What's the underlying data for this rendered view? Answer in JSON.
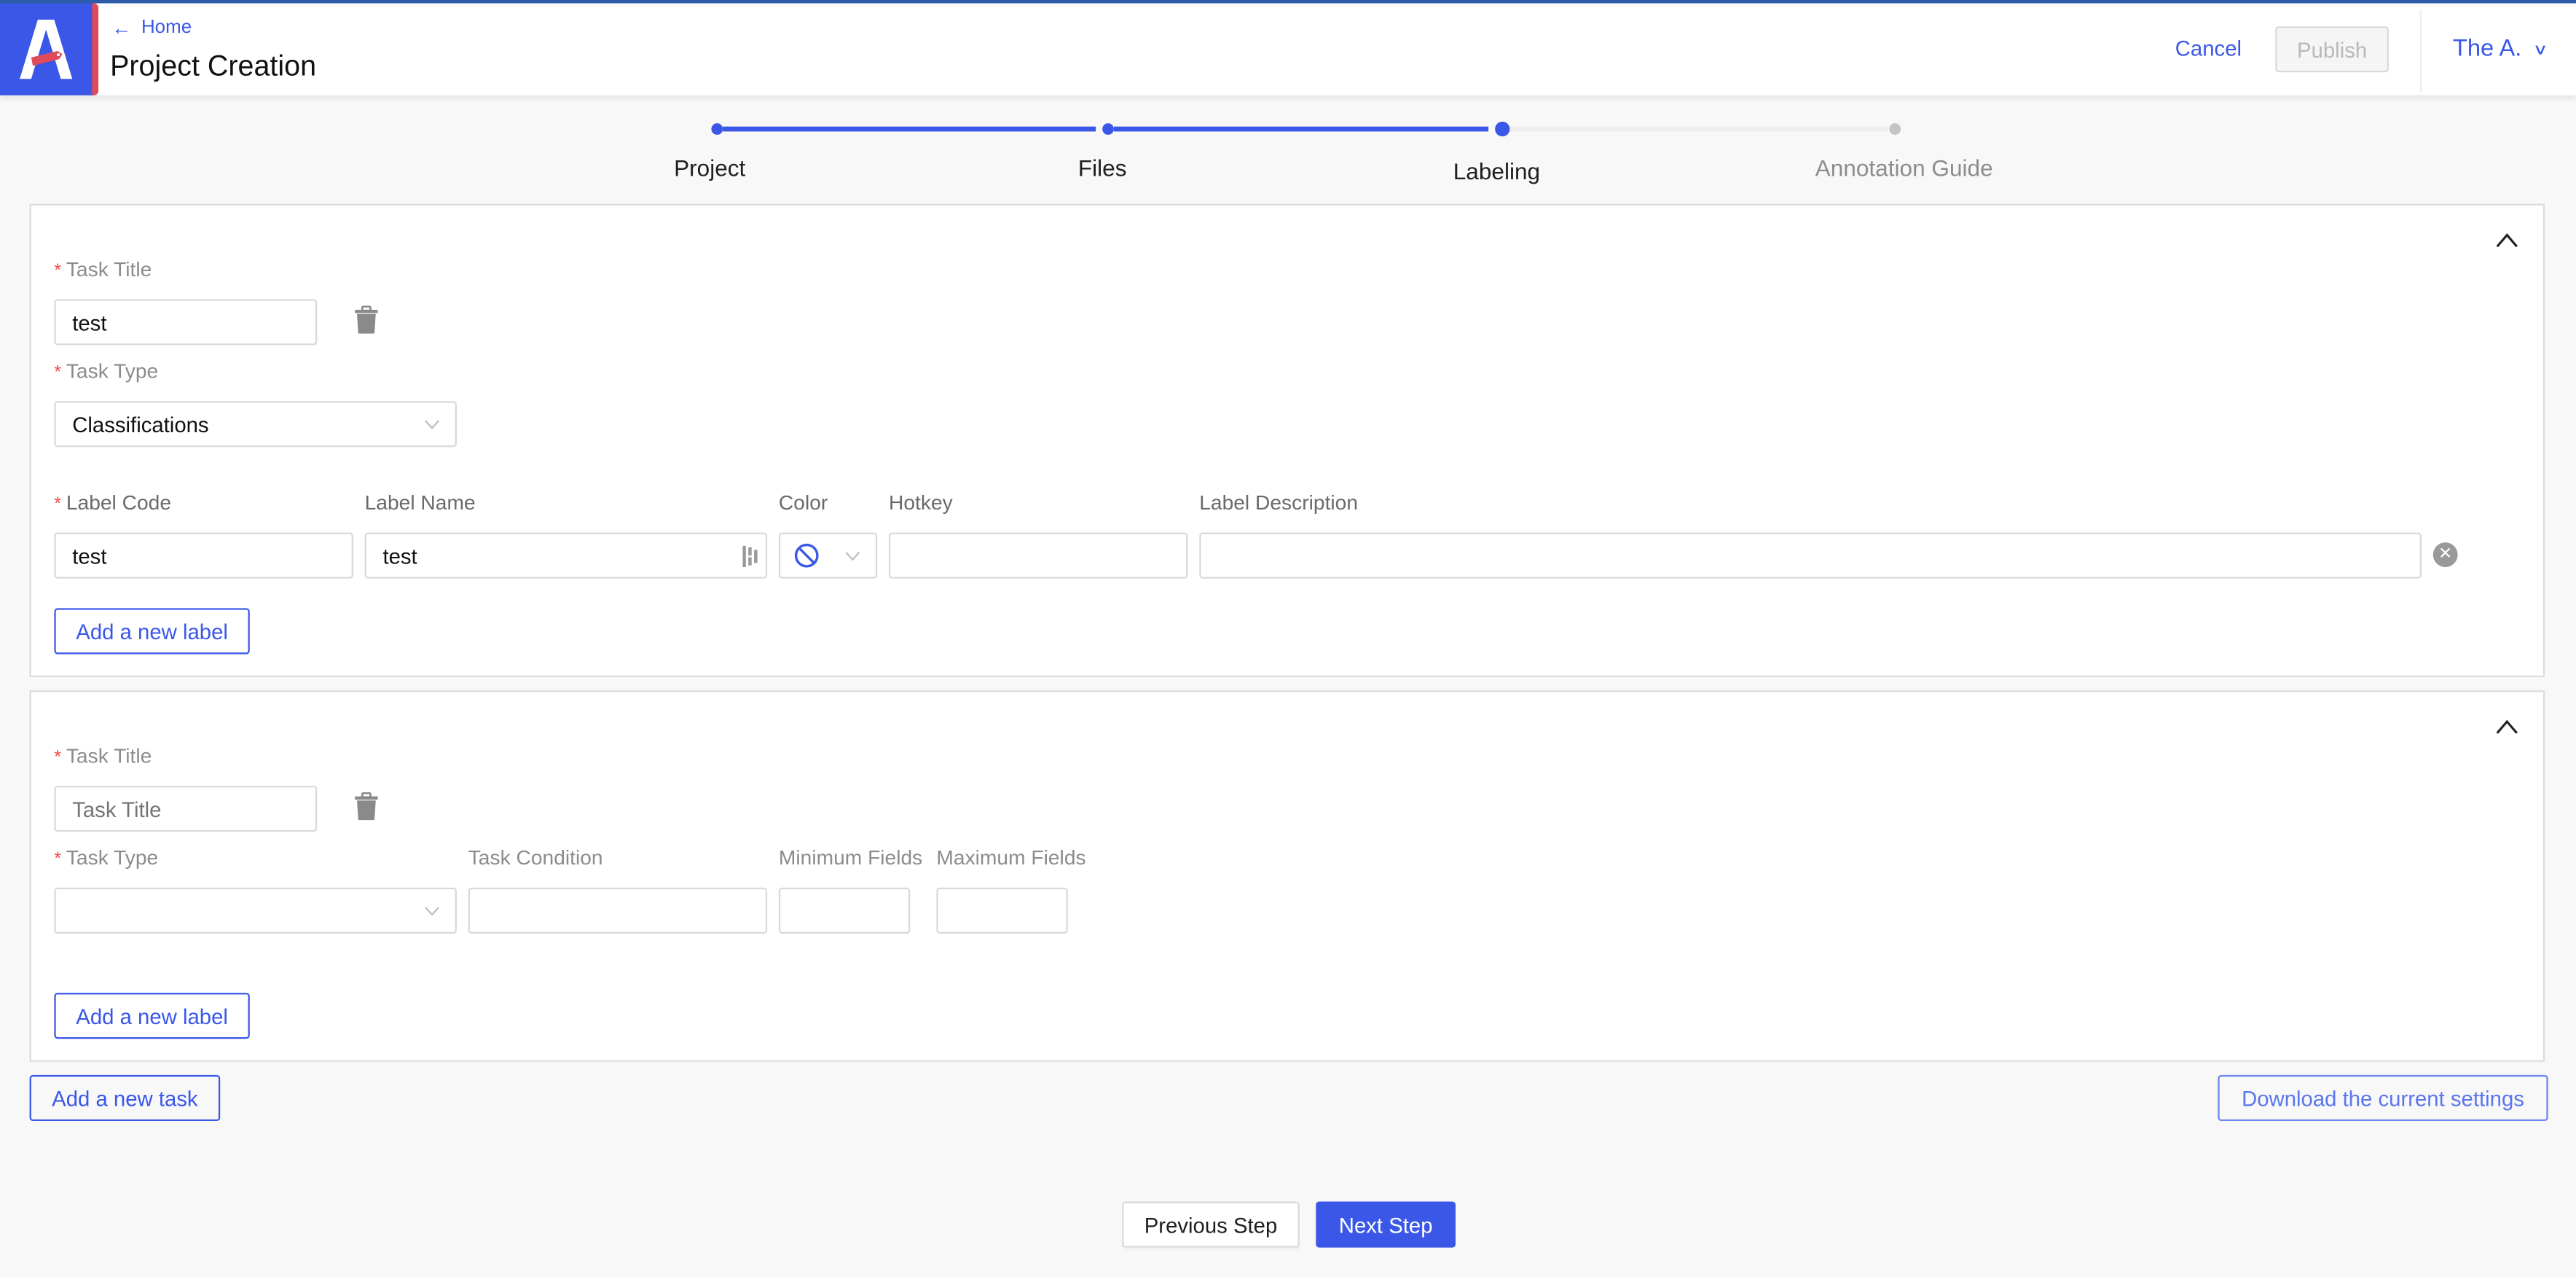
{
  "header": {
    "back_link": "Home",
    "title": "Project Creation",
    "cancel_label": "Cancel",
    "publish_label": "Publish",
    "user_name": "The A."
  },
  "colors": {
    "accent": "#3a57e8",
    "logo_stripe": "#e04b5a",
    "required": "#f24848",
    "disabled_text": "#b8b8b8"
  },
  "stepper": {
    "current_index": 2,
    "steps": [
      {
        "label": "Project",
        "status": "done"
      },
      {
        "label": "Files",
        "status": "done"
      },
      {
        "label": "Labeling",
        "status": "current"
      },
      {
        "label": "Annotation Guide",
        "status": "todo"
      }
    ]
  },
  "tasks": [
    {
      "title_label": "Task Title",
      "title_value": "test",
      "type_label": "Task Type",
      "type_value": "Classifications",
      "label_columns": {
        "code": "Label Code",
        "name": "Label Name",
        "color": "Color",
        "hotkey": "Hotkey",
        "description": "Label Description"
      },
      "labels": [
        {
          "code": "test",
          "name": "test",
          "color": "none",
          "hotkey": "",
          "description": ""
        }
      ],
      "add_label_button": "Add a new label"
    },
    {
      "title_label": "Task Title",
      "title_value": "",
      "title_placeholder": "Task Title",
      "type_label": "Task Type",
      "type_value": "",
      "condition_label": "Task Condition",
      "condition_value": "",
      "min_fields_label": "Minimum Fields",
      "min_fields_value": "",
      "max_fields_label": "Maximum Fields",
      "max_fields_value": "",
      "add_label_button": "Add a new label"
    }
  ],
  "actions": {
    "add_task_button": "Add a new task",
    "download_button": "Download the current settings",
    "previous_button": "Previous Step",
    "next_button": "Next Step"
  }
}
